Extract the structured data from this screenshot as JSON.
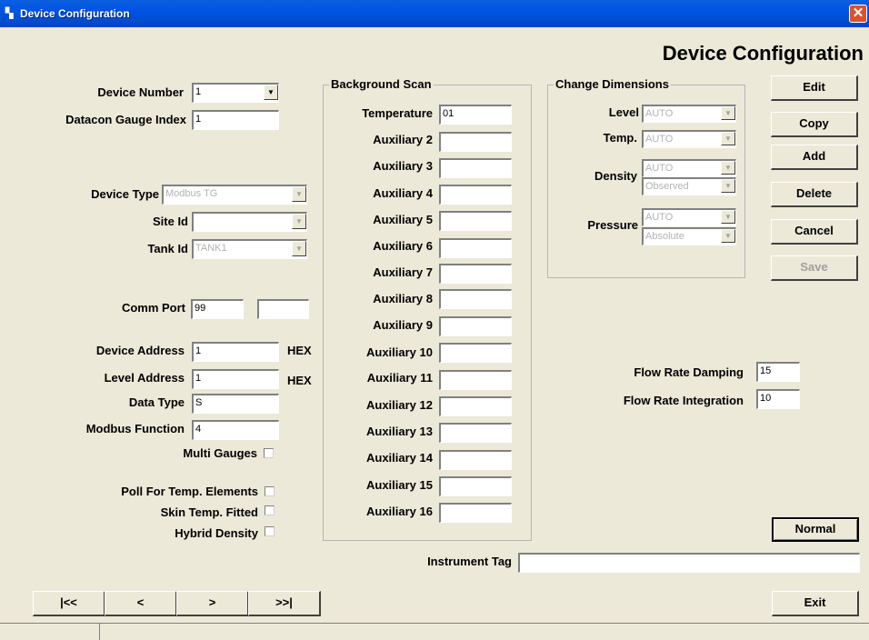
{
  "window": {
    "title": "Device Configuration",
    "close_glyph": "✕",
    "icon": "device-config-icon"
  },
  "header": "Device Configuration",
  "left": {
    "device_number_label": "Device Number",
    "device_number": "1",
    "datacon_gauge_index_label": "Datacon Gauge Index",
    "datacon_gauge_index": "1",
    "device_type_label": "Device Type",
    "device_type": "Modbus TG",
    "site_id_label": "Site Id",
    "site_id": "",
    "tank_id_label": "Tank Id",
    "tank_id": "TANK1",
    "comm_port_label": "Comm Port",
    "comm_port": "99",
    "comm_port_2": "",
    "device_address_label": "Device Address",
    "device_address": "1",
    "device_address_unit": "HEX",
    "level_address_label": "Level Address",
    "level_address": "1",
    "level_address_unit": "HEX",
    "data_type_label": "Data Type",
    "data_type": "S",
    "modbus_function_label": "Modbus Function",
    "modbus_function": "4",
    "multi_gauges_label": "Multi Gauges",
    "poll_temp_label": "Poll For Temp. Elements",
    "skin_temp_label": "Skin Temp. Fitted",
    "hybrid_density_label": "Hybrid Density"
  },
  "background_scan": {
    "title": "Background Scan",
    "fields": [
      {
        "label": "Temperature",
        "value": "01"
      },
      {
        "label": "Auxiliary 2",
        "value": ""
      },
      {
        "label": "Auxiliary 3",
        "value": ""
      },
      {
        "label": "Auxiliary 4",
        "value": ""
      },
      {
        "label": "Auxiliary 5",
        "value": ""
      },
      {
        "label": "Auxiliary 6",
        "value": ""
      },
      {
        "label": "Auxiliary 7",
        "value": ""
      },
      {
        "label": "Auxiliary 8",
        "value": ""
      },
      {
        "label": "Auxiliary 9",
        "value": ""
      },
      {
        "label": "Auxiliary 10",
        "value": ""
      },
      {
        "label": "Auxiliary 11",
        "value": ""
      },
      {
        "label": "Auxiliary 12",
        "value": ""
      },
      {
        "label": "Auxiliary 13",
        "value": ""
      },
      {
        "label": "Auxiliary 14",
        "value": ""
      },
      {
        "label": "Auxiliary 15",
        "value": ""
      },
      {
        "label": "Auxiliary 16",
        "value": ""
      }
    ]
  },
  "change_dimensions": {
    "title": "Change Dimensions",
    "level_label": "Level",
    "level": "AUTO",
    "temp_label": "Temp.",
    "temp": "AUTO",
    "density_label": "Density",
    "density": "AUTO",
    "density_mode": "Observed",
    "pressure_label": "Pressure",
    "pressure": "AUTO",
    "pressure_mode": "Absolute"
  },
  "buttons": {
    "edit": "Edit",
    "copy": "Copy",
    "add": "Add",
    "delete": "Delete",
    "cancel": "Cancel",
    "save": "Save",
    "normal": "Normal",
    "exit": "Exit",
    "first": "|<<",
    "prev": "<",
    "next": ">",
    "last": ">>|"
  },
  "flow": {
    "damping_label": "Flow Rate Damping",
    "damping": "15",
    "integration_label": "Flow Rate Integration",
    "integration": "10"
  },
  "instrument_tag_label": "Instrument Tag",
  "instrument_tag": ""
}
